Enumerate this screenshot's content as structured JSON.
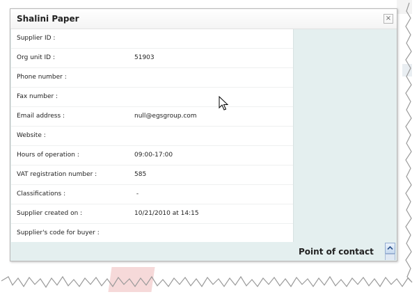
{
  "dialog": {
    "title": "Shalini Paper",
    "close_glyph": "×"
  },
  "fields": [
    {
      "label": "Supplier ID :",
      "value": ""
    },
    {
      "label": "Org unit ID :",
      "value": "51903"
    },
    {
      "label": "Phone number :",
      "value": ""
    },
    {
      "label": "Fax number :",
      "value": ""
    },
    {
      "label": "Email address :",
      "value": "null@egsgroup.com"
    },
    {
      "label": "Website :",
      "value": ""
    },
    {
      "label": "Hours of operation :",
      "value": "09:00-17:00"
    },
    {
      "label": "VAT registration number :",
      "value": "585"
    },
    {
      "label": "Classifications :",
      "value": " -"
    },
    {
      "label": "Supplier created on :",
      "value": "10/21/2010 at 14:15"
    },
    {
      "label": "Supplier's code for buyer :",
      "value": ""
    }
  ],
  "point_of_contact": {
    "label": "Point of contact"
  },
  "icons": {
    "close": "close-icon",
    "scroll_up": "chevron-up-icon",
    "cursor": "mouse-pointer-icon"
  },
  "colors": {
    "panel_bg": "#e4efef",
    "title_text": "#222222",
    "scroll_button": "#c6d9ef"
  }
}
